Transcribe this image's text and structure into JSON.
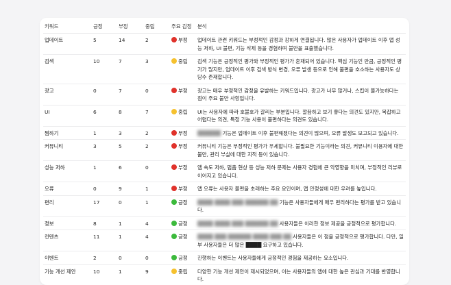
{
  "table": {
    "headers": [
      "키워드",
      "긍정",
      "부정",
      "중립",
      "주요 감정",
      "분석"
    ],
    "rows": [
      {
        "keyword": "업데이트",
        "pos": "5",
        "neg": "14",
        "neu": "2",
        "emotion": "부정",
        "tone": "neg",
        "blur": "",
        "analysis": "업데이트 관련 키워드는 부정적인 감정과 강하게 연결됩니다. 많은 사용자가 업데이트 이후 앱 성능 저하, UI 불편, 기능 삭제 등을 경험하며 불만을 표출했습니다."
      },
      {
        "keyword": "검색",
        "pos": "10",
        "neg": "7",
        "neu": "3",
        "emotion": "중립",
        "tone": "neu",
        "blur": "",
        "analysis": "검색 기능은 긍정적인 평가와 부정적인 평가가 혼재되어 있습니다. 핵심 기능인 만큼, 긍정적인 평가가 많지만, 업데이트 이후 검색 방식 변경, 오류 발생 등으로 인해 불편을 호소하는 사용자도 상당수 존재합니다."
      },
      {
        "keyword": "광고",
        "pos": "0",
        "neg": "7",
        "neu": "0",
        "emotion": "부정",
        "tone": "neg",
        "blur": "",
        "analysis": "광고는 매우 부정적인 감정을 유발하는 키워드입니다. 광고가 너무 많거나, 스킵이 불가능하다는 점이 주요 불만 사항입니다."
      },
      {
        "keyword": "UI",
        "pos": "6",
        "neg": "8",
        "neu": "7",
        "emotion": "중립",
        "tone": "neu",
        "blur": "",
        "analysis": "UI는 사용자에 따라 호불호가 갈리는 부분입니다. 깔끔하고 보기 좋다는 의견도 있지만, 복잡하고 어렵다는 의견, 특정 기능 사용이 불편하다는 의견도 있습니다."
      },
      {
        "keyword": "찜하기",
        "pos": "1",
        "neg": "3",
        "neu": "2",
        "emotion": "부정",
        "tone": "neg",
        "blur": "██████",
        "analysis": "기능은 업데이트 이후 불편해졌다는 의견이 많으며, 오류 발생도 보고되고 있습니다."
      },
      {
        "keyword": "커뮤니티",
        "pos": "3",
        "neg": "5",
        "neu": "2",
        "emotion": "부정",
        "tone": "neg",
        "blur": "",
        "analysis": "커뮤니티 기능은 부정적인 평가가 우세합니다. 불필요한 기능이라는 의견, 커뮤니티 이용자에 대한 불만, 관리 부실에 대한 지적 등이 있습니다."
      },
      {
        "keyword": "성능 저하",
        "pos": "1",
        "neg": "6",
        "neu": "0",
        "emotion": "부정",
        "tone": "neg",
        "blur": "",
        "analysis": "앱 속도 저하, 멈춤 현상 등 성능 저하 문제는 사용자 경험에 큰 악영향을 미치며, 부정적인 리뷰로 이어지고 있습니다."
      },
      {
        "keyword": "오류",
        "pos": "0",
        "neg": "9",
        "neu": "1",
        "emotion": "부정",
        "tone": "neg",
        "blur": "",
        "analysis": "앱 오류는 사용자 불편을 초래하는 주요 요인이며, 앱 안정성에 대한 우려를 높입니다."
      },
      {
        "keyword": "편리",
        "pos": "17",
        "neg": "0",
        "neu": "1",
        "emotion": "긍정",
        "tone": "pos",
        "blur": "████ ████ ███ ██████ ██",
        "analysis": "기능은 사용자들에게 매우 편리하다는 평가를 받고 있습니다."
      },
      {
        "keyword": "정보",
        "pos": "8",
        "neg": "1",
        "neu": "4",
        "emotion": "긍정",
        "tone": "pos",
        "blur": "████ ████ ███ ██████ ██",
        "analysis": "사용자들은 이러한 정보 제공을 긍정적으로 평가합니다."
      },
      {
        "keyword": "컨텐츠",
        "pos": "11",
        "neg": "1",
        "neu": "4",
        "emotion": "긍정",
        "tone": "pos",
        "blur": "████ ███ ██████ ████ ███ ██",
        "analysis": "사용자들은 이 점을 긍정적으로 평가합니다. 다만, 일부 사용자들은 더 많은 ████ 요구하고 있습니다."
      },
      {
        "keyword": "이벤트",
        "pos": "2",
        "neg": "0",
        "neu": "0",
        "emotion": "긍정",
        "tone": "pos",
        "blur": "",
        "analysis": "진행하는 이벤트는 사용자들에게 긍정적인 경험을 제공하는 요소입니다."
      },
      {
        "keyword": "기능 개선 제안",
        "pos": "10",
        "neg": "1",
        "neu": "9",
        "emotion": "중립",
        "tone": "neu",
        "blur": "",
        "analysis": "다양한 기능 개선 제안이 제시되었으며, 이는 사용자들의 앱에 대한 높은 관심과 기대를 반영합니다."
      }
    ]
  },
  "colors": {
    "negative": "#e0322b",
    "neutral": "#f6c12e",
    "positive": "#3cba3c"
  }
}
